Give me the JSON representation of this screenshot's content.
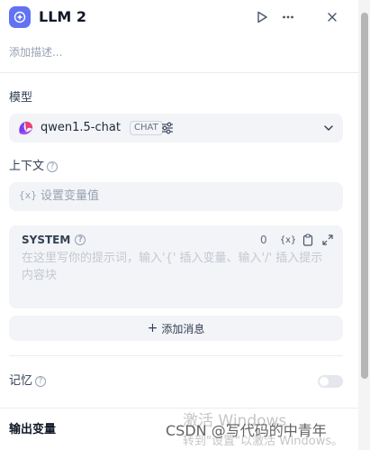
{
  "node": {
    "title": "LLM 2",
    "description_placeholder": "添加描述..."
  },
  "model_section": {
    "label": "模型",
    "model_name": "qwen1.5-chat",
    "mode_badge": "CHAT"
  },
  "context_section": {
    "label": "上下文",
    "help": "?",
    "var_icon": "{x}",
    "placeholder": "设置变量值"
  },
  "system_prompt": {
    "title": "SYSTEM",
    "help": "?",
    "char_count": "0",
    "placeholder": "在这里写你的提示词，输入'{' 插入变量、输入'/' 插入提示内容块"
  },
  "add_message": {
    "plus": "+",
    "label": "添加消息"
  },
  "memory": {
    "label": "记忆",
    "help": "?",
    "enabled": false
  },
  "output": {
    "label": "输出变量"
  },
  "watermarks": {
    "activate_title": "激活 Windows",
    "activate_hint": "转到\"设置\"以激活 Windows。",
    "csdn": "CSDN @写代码的中青年"
  },
  "colors": {
    "accent": "#6172f3",
    "panel": "#ffffff",
    "field_bg": "#f2f4f7"
  },
  "icons": [
    "llm-node-icon",
    "play-icon",
    "more-icon",
    "close-icon",
    "qwen-logo-icon",
    "settings-sliders-icon",
    "chevron-down-icon",
    "help-icon",
    "variable-icon",
    "clipboard-icon",
    "expand-icon",
    "plus-icon"
  ]
}
